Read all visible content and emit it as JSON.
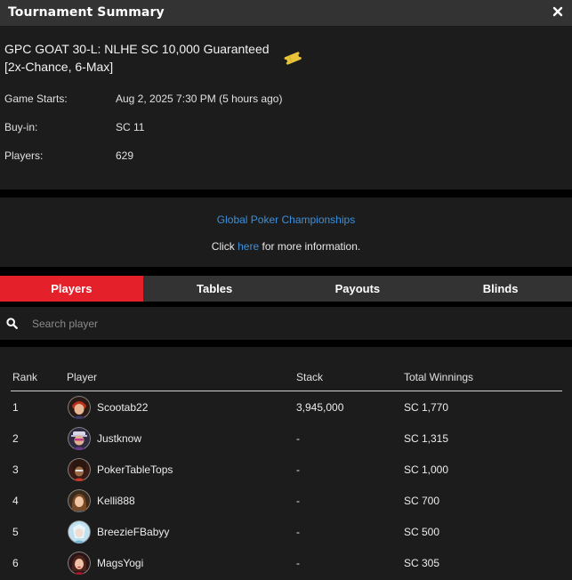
{
  "window": {
    "title": "Tournament Summary"
  },
  "tournament": {
    "name": "GPC GOAT 30-L: NLHE SC 10,000 Guaranteed [2x-Chance, 6-Max]",
    "details": [
      {
        "label": "Game Starts:",
        "value": "Aug 2, 2025 7:30 PM (5 hours ago)"
      },
      {
        "label": "Buy-in:",
        "value": "SC 11"
      },
      {
        "label": "Players:",
        "value": "629"
      }
    ]
  },
  "promo": {
    "link_text": "Global Poker Championships",
    "more_prefix": "Click ",
    "more_link": "here",
    "more_suffix": " for more information."
  },
  "tabs": [
    {
      "label": "Players",
      "active": true
    },
    {
      "label": "Tables",
      "active": false
    },
    {
      "label": "Payouts",
      "active": false
    },
    {
      "label": "Blinds",
      "active": false
    }
  ],
  "search": {
    "placeholder": "Search player"
  },
  "table": {
    "headers": {
      "rank": "Rank",
      "player": "Player",
      "stack": "Stack",
      "winnings": "Total Winnings"
    },
    "rows": [
      {
        "rank": "1",
        "player": "Scootab22",
        "stack": "3,945,000",
        "winnings": "SC 1,770",
        "avatar": "avatar-red-hair"
      },
      {
        "rank": "2",
        "player": "Justknow",
        "stack": "-",
        "winnings": "SC 1,315",
        "avatar": "avatar-hat-sunglasses"
      },
      {
        "rank": "3",
        "player": "PokerTableTops",
        "stack": "-",
        "winnings": "SC 1,000",
        "avatar": "avatar-afro"
      },
      {
        "rank": "4",
        "player": "Kelli888",
        "stack": "-",
        "winnings": "SC 700",
        "avatar": "avatar-woman-long-hair"
      },
      {
        "rank": "5",
        "player": "BreezieFBabyy",
        "stack": "-",
        "winnings": "SC 500",
        "avatar": "avatar-blue-ice"
      },
      {
        "rank": "6",
        "player": "MagsYogi",
        "stack": "-",
        "winnings": "SC 305",
        "avatar": "avatar-woman-red"
      }
    ]
  },
  "colors": {
    "active_tab": "#e4212b",
    "link": "#3d8fd9",
    "panel": "#1c1c1c",
    "header": "#333333"
  }
}
